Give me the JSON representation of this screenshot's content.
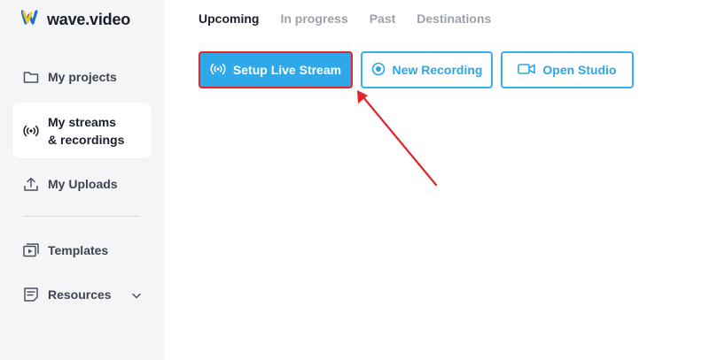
{
  "brand": {
    "name": "wave.video",
    "accent": "#2fa8ea",
    "logo_yellow": "#f5c518",
    "logo_blue": "#1f6fd1"
  },
  "sidebar": {
    "items": [
      {
        "label": "My projects",
        "icon": "folder-icon"
      },
      {
        "label_line1": "My streams",
        "label_line2": "& recordings",
        "icon": "broadcast-icon",
        "active": true
      },
      {
        "label": "My Uploads",
        "icon": "upload-icon"
      },
      {
        "label": "Templates",
        "icon": "templates-icon"
      },
      {
        "label": "Resources",
        "icon": "resources-icon",
        "dropdown": "chevron-down-icon"
      }
    ]
  },
  "tabs": [
    {
      "label": "Upcoming",
      "active": true
    },
    {
      "label": "In progress"
    },
    {
      "label": "Past"
    },
    {
      "label": "Destinations"
    }
  ],
  "actions": {
    "setup_live_stream": "Setup Live Stream",
    "new_recording": "New Recording",
    "open_studio": "Open Studio"
  },
  "annotation": {
    "color": "#e0252b",
    "type": "arrow pointing to Setup Live Stream button"
  }
}
